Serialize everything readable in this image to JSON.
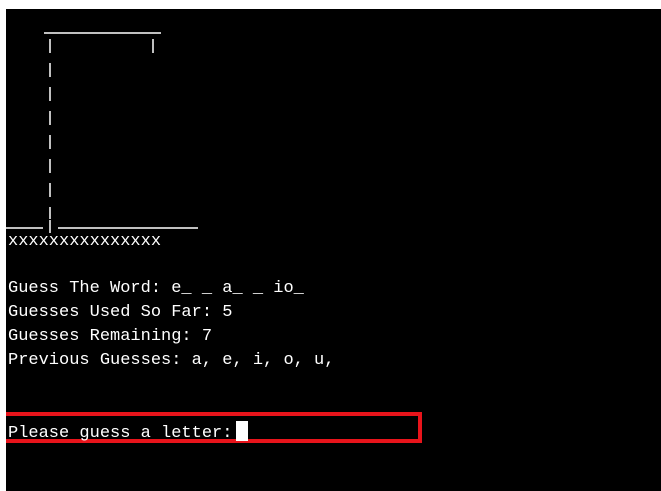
{
  "terminal": {
    "floor_line": "xxxxxxxxxxxxxxx",
    "word_label": "Guess The Word:",
    "word_value": "e_ _ a_ _ io_",
    "used_label": "Guesses Used So Far:",
    "used_value": "5",
    "remaining_label": "Guesses Remaining:",
    "remaining_value": "7",
    "previous_label": "Previous Guesses:",
    "previous_value": "a, e, i, o, u,",
    "prompt": "Please guess a letter:"
  },
  "colors": {
    "background": "#000000",
    "text": "#ffffff",
    "highlight": "#e8141b"
  }
}
